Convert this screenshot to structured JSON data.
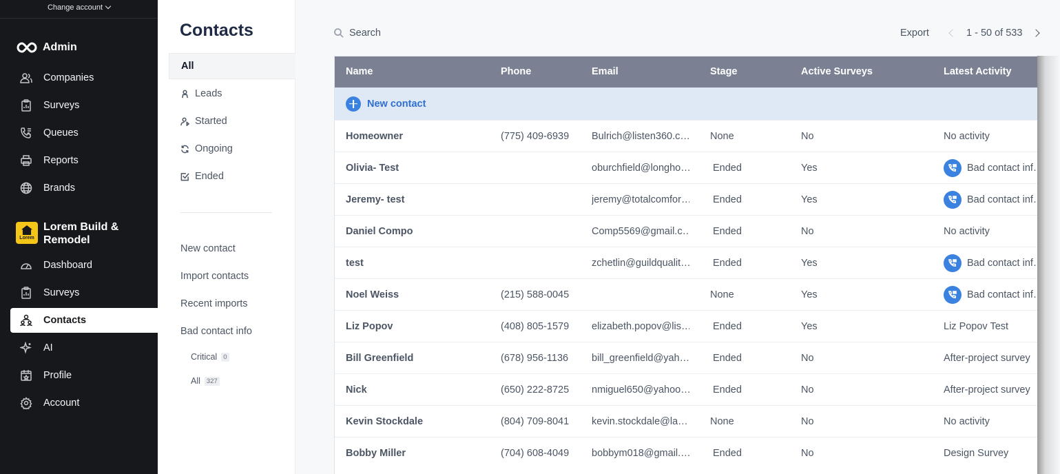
{
  "sidebar": {
    "change_account": "Change account",
    "admin_label": "Admin",
    "admin_items": [
      {
        "label": "Companies",
        "icon": "companies-icon"
      },
      {
        "label": "Surveys",
        "icon": "survey-icon"
      },
      {
        "label": "Queues",
        "icon": "queue-phone-icon"
      },
      {
        "label": "Reports",
        "icon": "printer-icon"
      },
      {
        "label": "Brands",
        "icon": "globe-icon"
      }
    ],
    "org": {
      "name": "Lorem Build & Remodel",
      "logo_text": "Lorem"
    },
    "org_items": [
      {
        "label": "Dashboard",
        "icon": "gauge-icon"
      },
      {
        "label": "Surveys",
        "icon": "survey-icon"
      },
      {
        "label": "Contacts",
        "icon": "contacts-icon",
        "active": true
      },
      {
        "label": "AI",
        "icon": "sparkle-icon"
      },
      {
        "label": "Profile",
        "icon": "profile-icon"
      },
      {
        "label": "Account",
        "icon": "gear-icon"
      }
    ]
  },
  "subnav": {
    "title": "Contacts",
    "filters": [
      {
        "label": "All",
        "active": true
      },
      {
        "label": "Leads",
        "icon": "lead-icon"
      },
      {
        "label": "Started",
        "icon": "started-icon"
      },
      {
        "label": "Ongoing",
        "icon": "refresh-icon"
      },
      {
        "label": "Ended",
        "icon": "check-square-icon"
      }
    ],
    "actions": [
      "New contact",
      "Import contacts",
      "Recent imports",
      "Bad contact info"
    ],
    "bad_contact": [
      {
        "label": "Critical",
        "count": "0"
      },
      {
        "label": "All",
        "count": "327"
      }
    ]
  },
  "toolbar": {
    "search_placeholder": "Search",
    "export_label": "Export",
    "pagination": "1 - 50 of 533"
  },
  "table": {
    "headers": [
      "Name",
      "Phone",
      "Email",
      "Stage",
      "Active Surveys",
      "Latest Activity"
    ],
    "new_contact_label": "New contact",
    "rows": [
      {
        "name": "Homeowner",
        "phone": "(775) 409-6939",
        "email": "Bulrich@listen360.c…",
        "stage": "None",
        "active": "No",
        "activity": "No activity",
        "icon": false
      },
      {
        "name": "Olivia- Test",
        "phone": "",
        "email": "oburchfield@longho…",
        "stage": "Ended",
        "active": "Yes",
        "activity": "Bad contact inf…",
        "icon": true
      },
      {
        "name": "Jeremy- test",
        "phone": "",
        "email": "jeremy@totalcomfor…",
        "stage": "Ended",
        "active": "Yes",
        "activity": "Bad contact inf…",
        "icon": true
      },
      {
        "name": "Daniel Compo",
        "phone": "",
        "email": "Comp5569@gmail.c…",
        "stage": "Ended",
        "active": "No",
        "activity": "No activity",
        "icon": false
      },
      {
        "name": "test",
        "phone": "",
        "email": "zchetlin@guildqualit…",
        "stage": "Ended",
        "active": "Yes",
        "activity": "Bad contact inf…",
        "icon": true
      },
      {
        "name": "Noel Weiss",
        "phone": "(215) 588-0045",
        "email": "",
        "stage": "None",
        "active": "Yes",
        "activity": "Bad contact inf…",
        "icon": true
      },
      {
        "name": "Liz Popov",
        "phone": "(408) 805-1579",
        "email": "elizabeth.popov@lis…",
        "stage": "Ended",
        "active": "Yes",
        "activity": "Liz Popov Test",
        "icon": false
      },
      {
        "name": "Bill Greenfield",
        "phone": "(678) 956-1136",
        "email": "bill_greenfield@yah…",
        "stage": "Ended",
        "active": "No",
        "activity": "After-project survey",
        "icon": false
      },
      {
        "name": "Nick",
        "phone": "(650) 222-8725",
        "email": "nmiguel650@yahoo…",
        "stage": "Ended",
        "active": "No",
        "activity": "After-project survey",
        "icon": false
      },
      {
        "name": "Kevin Stockdale",
        "phone": "(804) 709-8041",
        "email": "kevin.stockdale@la…",
        "stage": "None",
        "active": "No",
        "activity": "No activity",
        "icon": false
      },
      {
        "name": "Bobby Miller",
        "phone": "(704) 608-4049",
        "email": "bobbym018@gmail.…",
        "stage": "Ended",
        "active": "No",
        "activity": "Design Survey",
        "icon": false
      }
    ]
  }
}
